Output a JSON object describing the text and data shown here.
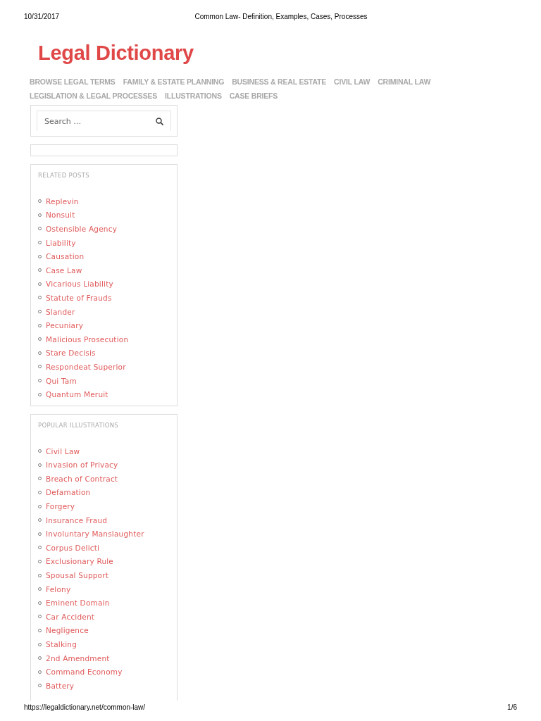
{
  "print_header": {
    "date": "10/31/2017",
    "title": "Common Law- Definition, Examples, Cases, Processes"
  },
  "site_title": "Legal Dictionary",
  "nav": [
    "BROWSE LEGAL TERMS",
    "FAMILY & ESTATE PLANNING",
    "BUSINESS & REAL ESTATE",
    "CIVIL LAW",
    "CRIMINAL LAW",
    "LEGISLATION & LEGAL PROCESSES",
    "ILLUSTRATIONS",
    "CASE BRIEFS"
  ],
  "search": {
    "placeholder": "Search …"
  },
  "widgets": [
    {
      "title": "RELATED POSTS",
      "links": [
        "Replevin",
        "Nonsuit",
        "Ostensible Agency",
        "Liability",
        "Causation",
        "Case Law",
        "Vicarious Liability",
        "Statute of Frauds",
        "Slander",
        "Pecuniary",
        "Malicious Prosecution",
        "Stare Decisis",
        "Respondeat Superior",
        "Qui Tam",
        "Quantum Meruit"
      ]
    },
    {
      "title": "POPULAR ILLUSTRATIONS",
      "links": [
        "Civil Law",
        "Invasion of Privacy",
        "Breach of Contract",
        "Defamation",
        "Forgery",
        "Insurance Fraud",
        "Involuntary Manslaughter",
        "Corpus Delicti",
        "Exclusionary Rule",
        "Spousal Support",
        "Felony",
        "Eminent Domain",
        "Car Accident",
        "Negligence",
        "Stalking",
        "2nd Amendment",
        "Command Economy",
        "Battery"
      ]
    }
  ],
  "print_footer": {
    "url": "https://legaldictionary.net/common-law/",
    "page": "1/6"
  }
}
